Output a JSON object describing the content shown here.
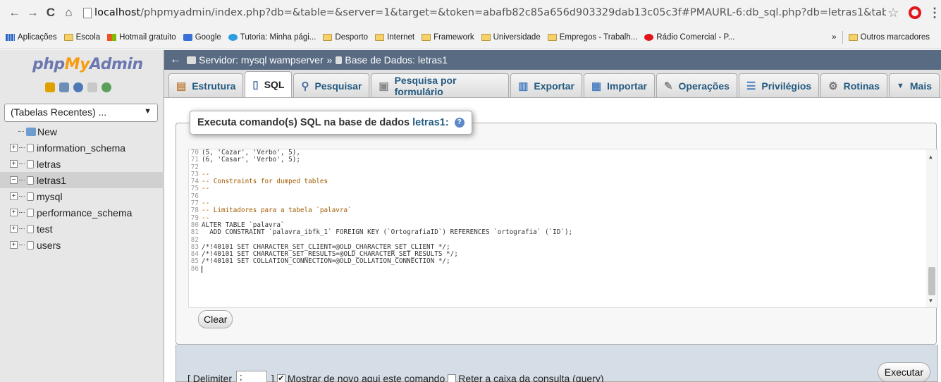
{
  "browser": {
    "url_host": "localhost",
    "url_rest": "/phpmyadmin/index.php?db=&table=&server=1&target=&token=abafb82c85a656d903329dab13c05c3f#PMAURL-6:db_sql.php?db=letras1&table=&",
    "bookmarks": [
      "Aplicações",
      "Escola",
      "Hotmail gratuito",
      "Google",
      "Tutoria: Minha pági...",
      "Desporto",
      "Internet",
      "Framework",
      "Universidade",
      "Empregos - Trabalh...",
      "Rádio Comercial - P..."
    ],
    "more": "»",
    "other_bookmarks": "Outros marcadores"
  },
  "nav": {
    "logo_php": "php",
    "logo_my": "My",
    "logo_admin": "Admin",
    "recent_select": "(Tabelas Recentes) ...",
    "new_label": "New",
    "databases": [
      {
        "name": "information_schema",
        "expander": "+"
      },
      {
        "name": "letras",
        "expander": "+"
      },
      {
        "name": "letras1",
        "expander": "−"
      },
      {
        "name": "mysql",
        "expander": "+"
      },
      {
        "name": "performance_schema",
        "expander": "+"
      },
      {
        "name": "test",
        "expander": "+"
      },
      {
        "name": "users",
        "expander": "+"
      }
    ]
  },
  "breadcrumb": {
    "server": "Servidor: mysql wampserver",
    "sep": "»",
    "database": "Base de Dados: letras1"
  },
  "tabs": [
    {
      "label": "Estrutura"
    },
    {
      "label": "SQL"
    },
    {
      "label": "Pesquisar"
    },
    {
      "label": "Pesquisa por formulário"
    },
    {
      "label": "Exportar"
    },
    {
      "label": "Importar"
    },
    {
      "label": "Operações"
    },
    {
      "label": "Privilégios"
    },
    {
      "label": "Rotinas"
    },
    {
      "label": "Mais"
    }
  ],
  "sql": {
    "legend_prefix": "Executa comando(s) SQL na base de dados",
    "legend_db": "letras1:",
    "help": "?",
    "lines": [
      {
        "n": "70",
        "text": "(5, 'Cazar', 'Verbo', 5),"
      },
      {
        "n": "71",
        "text": "(6, 'Casar', 'Verbo', 5);"
      },
      {
        "n": "72",
        "text": ""
      },
      {
        "n": "73",
        "text": "--"
      },
      {
        "n": "74",
        "text": "-- Constraints for dumped tables"
      },
      {
        "n": "75",
        "text": "--"
      },
      {
        "n": "76",
        "text": ""
      },
      {
        "n": "77",
        "text": "--"
      },
      {
        "n": "78",
        "text": "-- Limitadores para a tabela `palavra`"
      },
      {
        "n": "79",
        "text": "--"
      },
      {
        "n": "80",
        "text": "ALTER TABLE `palavra`"
      },
      {
        "n": "81",
        "text": "  ADD CONSTRAINT `palavra_ibfk_1` FOREIGN KEY (`OrtografiaID`) REFERENCES `ortografia` (`ID`);"
      },
      {
        "n": "82",
        "text": ""
      },
      {
        "n": "83",
        "text": "/*!40101 SET CHARACTER_SET_CLIENT=@OLD_CHARACTER_SET_CLIENT */;"
      },
      {
        "n": "84",
        "text": "/*!40101 SET CHARACTER_SET_RESULTS=@OLD_CHARACTER_SET_RESULTS */;"
      },
      {
        "n": "85",
        "text": "/*!40101 SET COLLATION_CONNECTION=@OLD_COLLATION_CONNECTION */;"
      },
      {
        "n": "86",
        "text": ""
      }
    ],
    "clear_label": "Clear"
  },
  "footer": {
    "delimiter_label": "[ Delimiter",
    "delimiter_value": ";",
    "delimiter_close": "]",
    "show_again_label": "Mostrar de novo aqui este comando",
    "show_again_checked": true,
    "retain_label": "Reter a caixa da consulta (query)",
    "retain_checked": false,
    "execute_label": "Executar"
  }
}
